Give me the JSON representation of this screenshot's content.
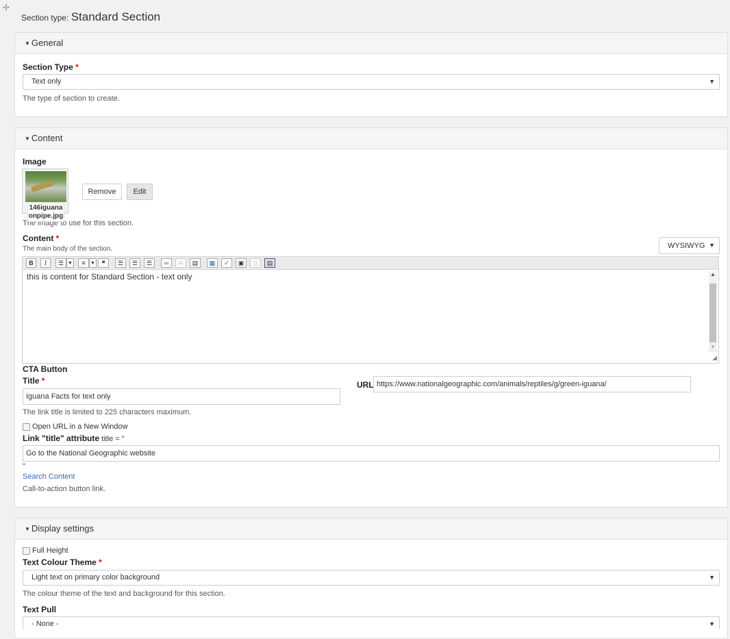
{
  "header": {
    "label": "Section type:",
    "value": "Standard Section"
  },
  "general": {
    "heading": "General",
    "section_type_label": "Section Type",
    "section_type_value": "Text only",
    "section_type_desc": "The type of section to create."
  },
  "content": {
    "heading": "Content",
    "image_label": "Image",
    "image_filename": "146iguanaonpipe.jpg",
    "remove_label": "Remove",
    "edit_label": "Edit",
    "image_desc": "The image to use for this section.",
    "content_label": "Content",
    "content_desc": "The main body of the section.",
    "editor_mode": "WYSIWYG",
    "editor_text": "this is content for Standard Section - text only",
    "toolbar_buttons": [
      "bold",
      "italic",
      "bulleted-list",
      "numbered-list",
      "blockquote",
      "align-left",
      "align-center",
      "align-right",
      "link",
      "unlink",
      "page-break",
      "table",
      "spellcheck",
      "image",
      "show-blocks",
      "toggle-toolbar"
    ],
    "cta_heading": "CTA Button",
    "title_label": "Title",
    "title_value": "Iguana Facts for text only",
    "title_desc": "The link title is limited to 225 characters maximum.",
    "url_label": "URL",
    "url_value": "https://www.nationalgeographic.com/animals/reptiles/g/green-iguana/",
    "new_window_label": "Open URL in a New Window",
    "title_attr_label": "Link \"title\" attribute",
    "title_attr_suffix": "title = \"",
    "title_attr_value": "Go to the National Geographic website",
    "title_attr_close": "\"",
    "search_link": "Search Content",
    "cta_desc": "Call-to-action button link."
  },
  "display": {
    "heading": "Display settings",
    "full_height_label": "Full Height",
    "text_colour_label": "Text Colour Theme",
    "text_colour_value": "Light text on primary color background",
    "text_colour_desc": "The colour theme of the text and background for this section.",
    "text_pull_label": "Text Pull",
    "text_pull_value": "- None -"
  },
  "colors": {
    "required": "#ee0000",
    "link": "#2a6ebb"
  }
}
